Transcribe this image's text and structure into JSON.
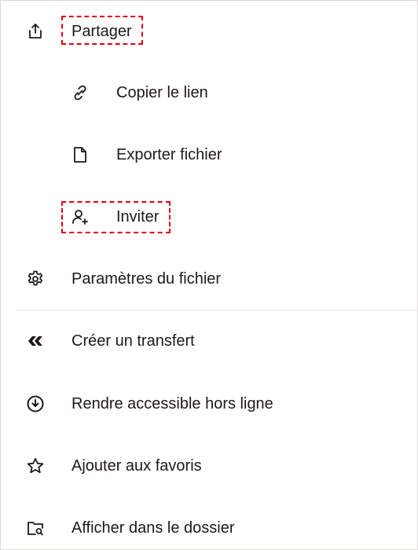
{
  "menu": {
    "share": {
      "label": "Partager",
      "icon": "share-upload-icon"
    },
    "copy_link": {
      "label": "Copier le lien",
      "icon": "link-icon"
    },
    "export_file": {
      "label": "Exporter fichier",
      "icon": "file-icon"
    },
    "invite": {
      "label": "Inviter",
      "icon": "person-add-icon"
    },
    "file_settings": {
      "label": "Paramètres du fichier",
      "icon": "gear-icon"
    },
    "create_transfer": {
      "label": "Créer un transfert",
      "icon": "transfer-icon"
    },
    "offline": {
      "label": "Rendre accessible hors ligne",
      "icon": "download-circle-icon"
    },
    "favorites": {
      "label": "Ajouter aux favoris",
      "icon": "star-icon"
    },
    "show_in_folder": {
      "label": "Afficher dans le dossier",
      "icon": "folder-search-icon"
    }
  },
  "colors": {
    "highlight": "#e60012",
    "text": "#1e1919",
    "divider": "#e5e2de"
  }
}
